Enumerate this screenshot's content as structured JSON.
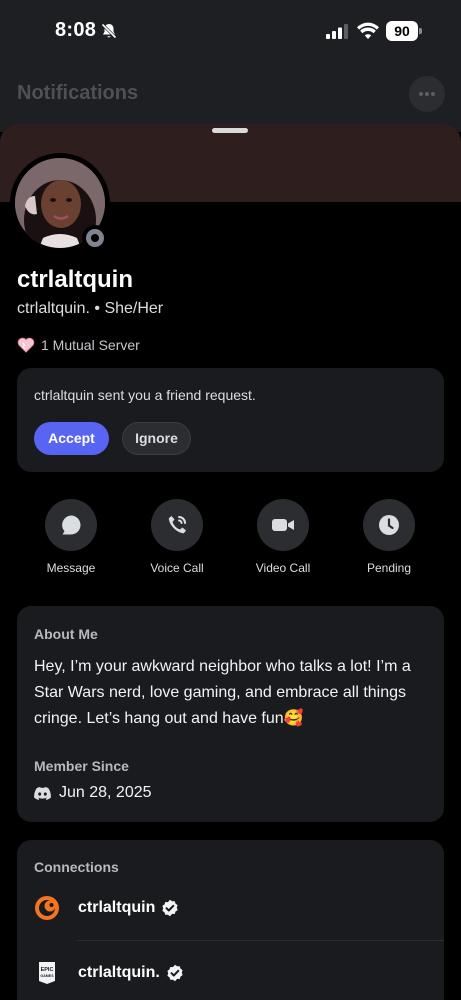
{
  "status_bar": {
    "time": "8:08",
    "battery": "90"
  },
  "background": {
    "title": "Notifications"
  },
  "profile": {
    "display_name": "ctrlaltquin",
    "username": "ctrlaltquin.",
    "separator": "•",
    "pronouns": "She/Her",
    "mutual_servers": "1 Mutual Server"
  },
  "friend_request": {
    "text": "ctrlaltquin sent you a friend request.",
    "accept_label": "Accept",
    "ignore_label": "Ignore"
  },
  "actions": [
    {
      "label": "Message",
      "icon": "message-icon"
    },
    {
      "label": "Voice Call",
      "icon": "voice-call-icon"
    },
    {
      "label": "Video Call",
      "icon": "video-call-icon"
    },
    {
      "label": "Pending",
      "icon": "clock-icon"
    }
  ],
  "about": {
    "title": "About Me",
    "bio": "Hey, I’m your awkward neighbor who talks a lot! I’m a Star Wars nerd, love gaming, and embrace all things cringe. Let’s hang out and have fun🥰",
    "member_since_title": "Member Since",
    "member_since_date": "Jun 28, 2025"
  },
  "connections": {
    "title": "Connections",
    "items": [
      {
        "service": "crunchyroll",
        "name": "ctrlaltquin",
        "verified": true
      },
      {
        "service": "epic-games",
        "name": "ctrlaltquin.",
        "verified": true
      }
    ]
  },
  "colors": {
    "accent": "#5865f2",
    "banner": "#2e1f1e",
    "card": "#1a1b1e",
    "crunchyroll": "#f47521"
  }
}
